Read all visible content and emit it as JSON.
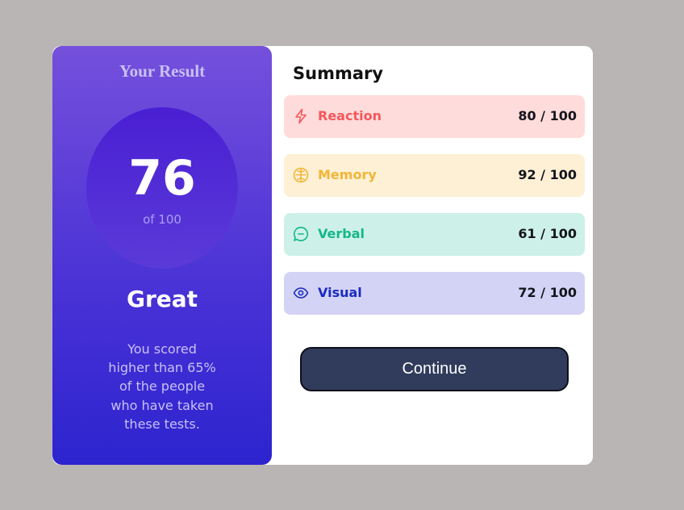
{
  "result": {
    "title": "Your Result",
    "score": "76",
    "score_of": "of 100",
    "grade": "Great",
    "description": "You scored higher than 65% of the people who have taken these tests."
  },
  "summary": {
    "title": "Summary",
    "items": [
      {
        "label": "Reaction",
        "score": "80 / 100",
        "icon": "lightning-icon",
        "color": "#f4585b",
        "background": "#fedcdb"
      },
      {
        "label": "Memory",
        "score": "92 / 100",
        "icon": "brain-icon",
        "color": "#f1b637",
        "background": "#fdf0d5"
      },
      {
        "label": "Verbal",
        "score": "61 / 100",
        "icon": "speech-bubble-icon",
        "color": "#14b78a",
        "background": "#cdf1e8"
      },
      {
        "label": "Visual",
        "score": "72 / 100",
        "icon": "eye-icon",
        "color": "#1a2ac0",
        "background": "#d3d3f5"
      }
    ]
  },
  "continue_label": "Continue",
  "colors": {
    "page_background": "#b9b5b4",
    "result_gradient_top": "#7550dc",
    "result_gradient_bottom": "#2d24cf",
    "button_background": "#313c5c"
  }
}
